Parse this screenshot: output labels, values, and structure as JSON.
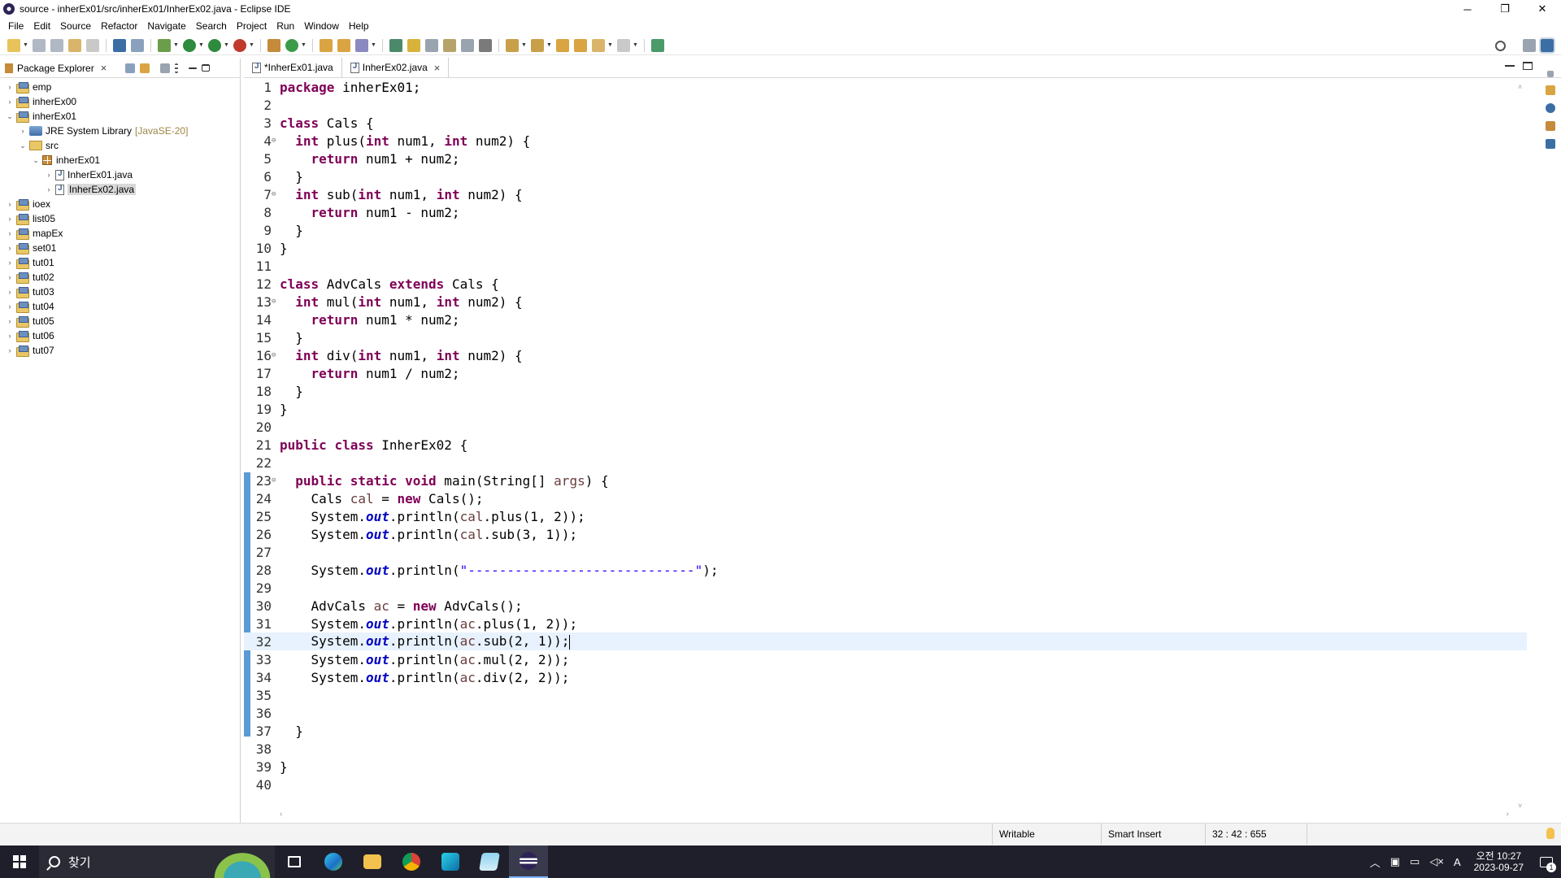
{
  "window": {
    "title": "source - inherEx01/src/inherEx01/InherEx02.java - Eclipse IDE",
    "minimize": "─",
    "restore": "❐",
    "close": "✕"
  },
  "menu": [
    "File",
    "Edit",
    "Source",
    "Refactor",
    "Navigate",
    "Search",
    "Project",
    "Run",
    "Window",
    "Help"
  ],
  "package_explorer": {
    "tab_label": "Package Explorer",
    "tree": [
      {
        "label": "emp",
        "type": "project",
        "indent": 0,
        "twisty": "›"
      },
      {
        "label": "inherEx00",
        "type": "project",
        "indent": 0,
        "twisty": "›"
      },
      {
        "label": "inherEx01",
        "type": "project",
        "indent": 0,
        "twisty": "⌄"
      },
      {
        "label": "JRE System Library",
        "deco": "[JavaSE-20]",
        "type": "library",
        "indent": 1,
        "twisty": "›"
      },
      {
        "label": "src",
        "type": "src",
        "indent": 1,
        "twisty": "⌄"
      },
      {
        "label": "inherEx01",
        "type": "package",
        "indent": 2,
        "twisty": "⌄"
      },
      {
        "label": "InherEx01.java",
        "type": "java",
        "indent": 3,
        "twisty": "›"
      },
      {
        "label": "InherEx02.java",
        "type": "java",
        "indent": 3,
        "twisty": "›",
        "selected": true
      },
      {
        "label": "ioex",
        "type": "project",
        "indent": 0,
        "twisty": "›"
      },
      {
        "label": "list05",
        "type": "project",
        "indent": 0,
        "twisty": "›"
      },
      {
        "label": "mapEx",
        "type": "project",
        "indent": 0,
        "twisty": "›"
      },
      {
        "label": "set01",
        "type": "project",
        "indent": 0,
        "twisty": "›"
      },
      {
        "label": "tut01",
        "type": "project",
        "indent": 0,
        "twisty": "›"
      },
      {
        "label": "tut02",
        "type": "project",
        "indent": 0,
        "twisty": "›"
      },
      {
        "label": "tut03",
        "type": "project",
        "indent": 0,
        "twisty": "›"
      },
      {
        "label": "tut04",
        "type": "project",
        "indent": 0,
        "twisty": "›"
      },
      {
        "label": "tut05",
        "type": "project",
        "indent": 0,
        "twisty": "›"
      },
      {
        "label": "tut06",
        "type": "project",
        "indent": 0,
        "twisty": "›"
      },
      {
        "label": "tut07",
        "type": "project",
        "indent": 0,
        "twisty": "›"
      }
    ]
  },
  "editor": {
    "tabs": [
      {
        "label": "*InherEx01.java",
        "active": false
      },
      {
        "label": "InherEx02.java",
        "active": true
      }
    ],
    "current_line": 32,
    "lines": [
      [
        [
          "kw",
          "package"
        ],
        [
          "",
          "  inherEx01;"
        ]
      ],
      [],
      [
        [
          "kw",
          "class"
        ],
        [
          "",
          "  Cals {"
        ]
      ],
      [
        [
          "",
          "    "
        ],
        [
          "kw",
          "int"
        ],
        [
          "",
          "  plus("
        ],
        [
          "kw",
          "int"
        ],
        [
          "",
          "  num1, "
        ],
        [
          "kw",
          "int"
        ],
        [
          "",
          "  num2) {"
        ]
      ],
      [
        [
          "",
          "        "
        ],
        [
          "kw",
          "return"
        ],
        [
          "",
          "  num1 + num2;"
        ]
      ],
      [
        [
          "",
          "    }"
        ]
      ],
      [
        [
          "",
          "    "
        ],
        [
          "kw",
          "int"
        ],
        [
          "",
          "  sub("
        ],
        [
          "kw",
          "int"
        ],
        [
          "",
          "  num1, "
        ],
        [
          "kw",
          "int"
        ],
        [
          "",
          "  num2) {"
        ]
      ],
      [
        [
          "",
          "        "
        ],
        [
          "kw",
          "return"
        ],
        [
          "",
          "  num1 - num2;"
        ]
      ],
      [
        [
          "",
          "    }"
        ]
      ],
      [
        [
          "",
          "}"
        ]
      ],
      [],
      [
        [
          "kw",
          "class"
        ],
        [
          "",
          "  AdvCals "
        ],
        [
          "kw",
          "extends"
        ],
        [
          "",
          "  Cals {"
        ]
      ],
      [
        [
          "",
          "    "
        ],
        [
          "kw",
          "int"
        ],
        [
          "",
          "  mul("
        ],
        [
          "kw",
          "int"
        ],
        [
          "",
          "  num1, "
        ],
        [
          "kw",
          "int"
        ],
        [
          "",
          "  num2) {"
        ]
      ],
      [
        [
          "",
          "        "
        ],
        [
          "kw",
          "return"
        ],
        [
          "",
          "  num1 * num2;"
        ]
      ],
      [
        [
          "",
          "    }"
        ]
      ],
      [
        [
          "",
          "    "
        ],
        [
          "kw",
          "int"
        ],
        [
          "",
          "  div("
        ],
        [
          "kw",
          "int"
        ],
        [
          "",
          "  num1, "
        ],
        [
          "kw",
          "int"
        ],
        [
          "",
          "  num2) {"
        ]
      ],
      [
        [
          "",
          "        "
        ],
        [
          "kw",
          "return"
        ],
        [
          "",
          "  num1 / num2;"
        ]
      ],
      [
        [
          "",
          "    }"
        ]
      ],
      [
        [
          "",
          "}"
        ]
      ],
      [],
      [
        [
          "kw",
          "public"
        ],
        [
          "",
          "  "
        ],
        [
          "kw",
          "class"
        ],
        [
          "",
          "  InherEx02 {"
        ]
      ],
      [],
      [
        [
          "",
          "    "
        ],
        [
          "kw",
          "public"
        ],
        [
          "",
          "  "
        ],
        [
          "kw",
          "static"
        ],
        [
          "",
          "  "
        ],
        [
          "kw",
          "void"
        ],
        [
          "",
          "  main(String[] "
        ],
        [
          "var",
          "args"
        ],
        [
          "",
          ") {"
        ]
      ],
      [
        [
          "",
          "        Cals "
        ],
        [
          "var",
          "cal"
        ],
        [
          "",
          "  = "
        ],
        [
          "kw",
          "new"
        ],
        [
          "",
          "  Cals();"
        ]
      ],
      [
        [
          "",
          "        System."
        ],
        [
          "fld",
          "out"
        ],
        [
          "",
          ".println("
        ],
        [
          "var",
          "cal"
        ],
        [
          "",
          ".plus(1, 2));"
        ]
      ],
      [
        [
          "",
          "        System."
        ],
        [
          "fld",
          "out"
        ],
        [
          "",
          ".println("
        ],
        [
          "var",
          "cal"
        ],
        [
          "",
          ".sub(3, 1));"
        ]
      ],
      [],
      [
        [
          "",
          "        System."
        ],
        [
          "fld",
          "out"
        ],
        [
          "",
          ".println("
        ],
        [
          "str",
          "\"-----------------------------\""
        ],
        [
          "",
          ");"
        ]
      ],
      [],
      [
        [
          "",
          "        AdvCals "
        ],
        [
          "var",
          "ac"
        ],
        [
          "",
          "  = "
        ],
        [
          "kw",
          "new"
        ],
        [
          "",
          "  AdvCals();"
        ]
      ],
      [
        [
          "",
          "        System."
        ],
        [
          "fld",
          "out"
        ],
        [
          "",
          ".println("
        ],
        [
          "var",
          "ac"
        ],
        [
          "",
          ".plus(1, 2));"
        ]
      ],
      [
        [
          "",
          "        System."
        ],
        [
          "fld",
          "out"
        ],
        [
          "",
          ".println("
        ],
        [
          "var",
          "ac"
        ],
        [
          "",
          ".sub(2, 1));"
        ],
        [
          "caret",
          ""
        ]
      ],
      [
        [
          "",
          "        System."
        ],
        [
          "fld",
          "out"
        ],
        [
          "",
          ".println("
        ],
        [
          "var",
          "ac"
        ],
        [
          "",
          ".mul(2, 2));"
        ]
      ],
      [
        [
          "",
          "        System."
        ],
        [
          "fld",
          "out"
        ],
        [
          "",
          ".println("
        ],
        [
          "var",
          "ac"
        ],
        [
          "",
          ".div(2, 2));"
        ]
      ],
      [],
      [],
      [
        [
          "",
          "    }"
        ]
      ],
      [],
      [
        [
          "",
          "}"
        ]
      ],
      []
    ],
    "fold_lines": [
      4,
      7,
      13,
      16,
      23
    ]
  },
  "status": {
    "writable": "Writable",
    "insert_mode": "Smart Insert",
    "position": "32 : 42 : 655"
  },
  "taskbar": {
    "search_placeholder": "찾기",
    "time": "오전 10:27",
    "date": "2023-09-27",
    "ime": "A",
    "notifications": "1"
  }
}
